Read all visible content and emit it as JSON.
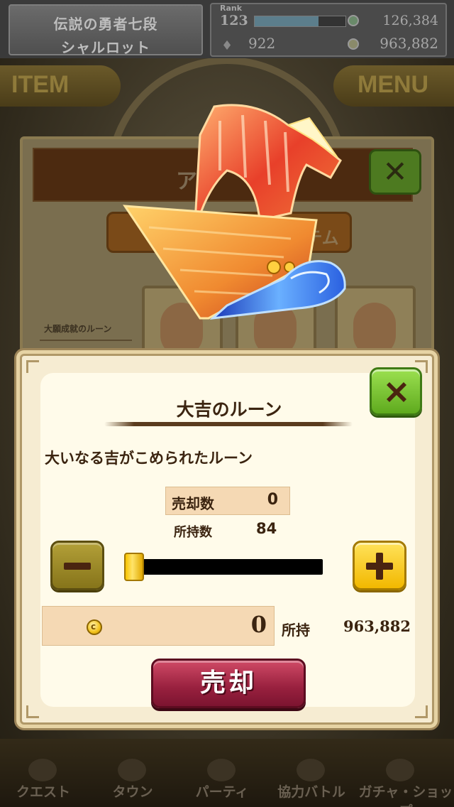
{
  "header": {
    "player_title": "伝説の勇者七段",
    "player_name": "シャルロット",
    "rank_label": "Rank",
    "rank": "123",
    "rank_progress": 0.7,
    "stamina": "126,384",
    "gems": "922",
    "coins": "963,882"
  },
  "side_buttons": {
    "item": "ITEM",
    "menu": "MENU"
  },
  "background_dialog": {
    "header_text": "ア",
    "tab_2_label": "テム",
    "sidebar_label": "大願成就のルーン"
  },
  "bottom_nav": [
    {
      "label": "クエスト"
    },
    {
      "label": "タウン"
    },
    {
      "label": "パーティ"
    },
    {
      "label": "協力バトル"
    },
    {
      "label": "ガチャ・ショップ"
    }
  ],
  "sell_dialog": {
    "item_name": "大吉のルーン",
    "description": "大いなる吉がこめられたルーン",
    "sell_count_label": "売却数",
    "sell_count": "0",
    "owned_label": "所持数",
    "owned_count": "84",
    "slider_value": 0,
    "price": "0",
    "held_label": "所持",
    "held_coins": "963,882",
    "sell_button": "売却",
    "coin_symbol": "c"
  },
  "colors": {
    "close_green": "#5faa1e",
    "plus_yellow": "#f2b800",
    "sell_red": "#98203e",
    "panel_cream": "#fffbea"
  },
  "icons": [
    "close-icon",
    "minus-icon",
    "plus-icon",
    "coin-icon",
    "rune-ship-icon",
    "gem-icon",
    "stamina-icon"
  ]
}
